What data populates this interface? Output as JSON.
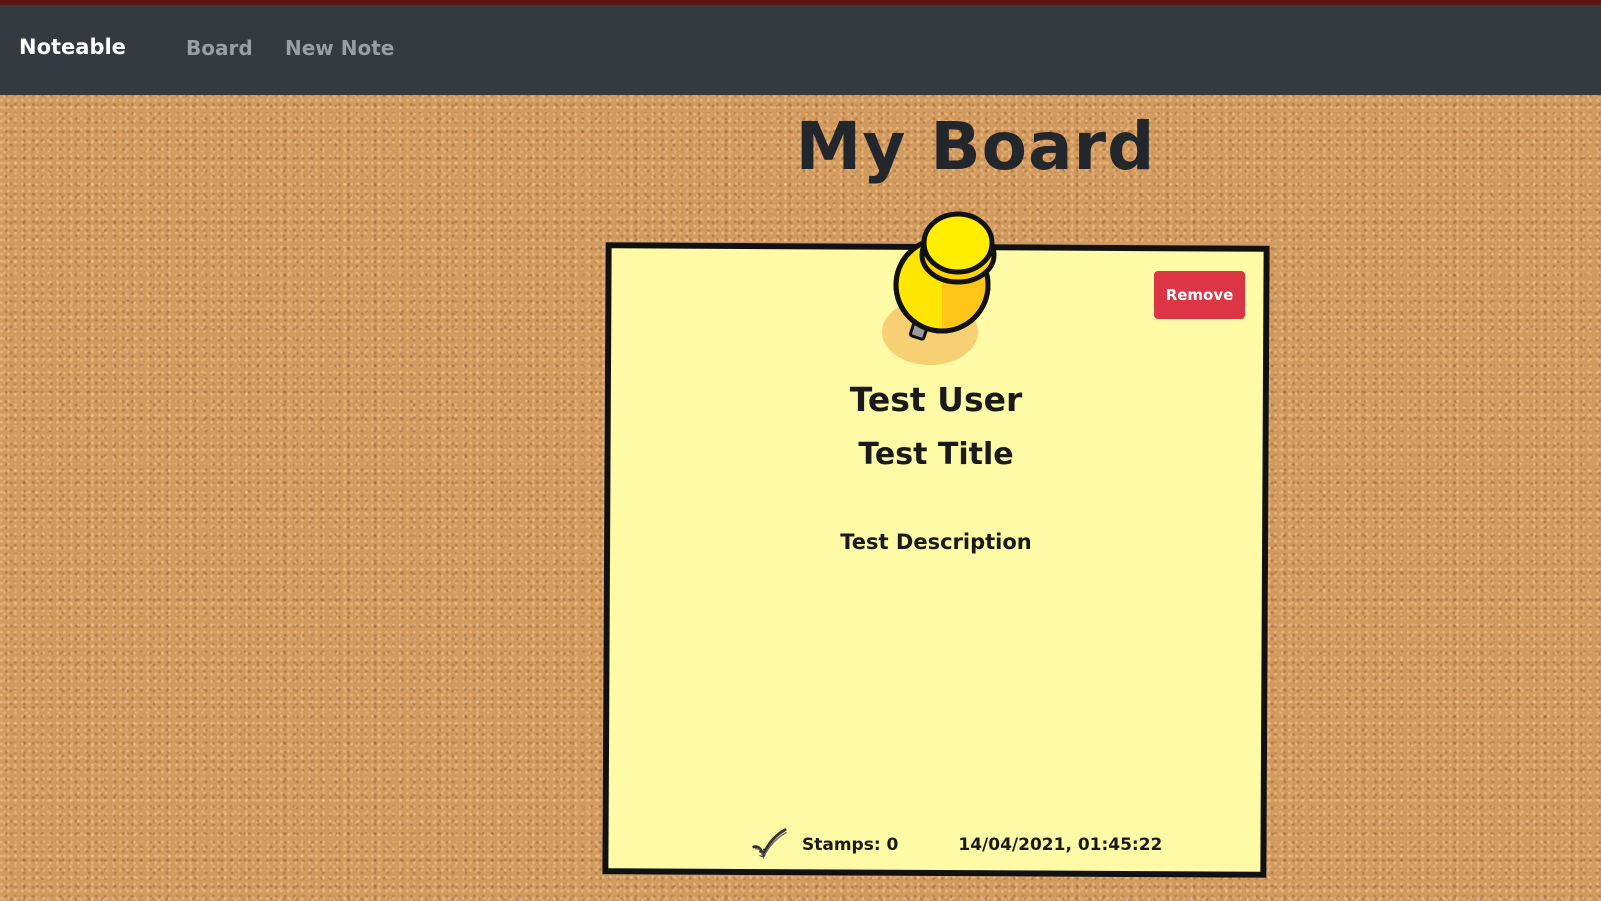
{
  "navbar": {
    "brand": "Noteable",
    "links": [
      {
        "label": "Board"
      },
      {
        "label": "New Note"
      }
    ]
  },
  "page": {
    "title": "My Board"
  },
  "note": {
    "user": "Test User",
    "title": "Test Title",
    "description": "Test Description",
    "remove_label": "Remove",
    "stamps_label": "Stamps: 0",
    "stamps_count": 0,
    "timestamp": "14/04/2021, 01:45:22",
    "pin_icon": "pushpin-icon",
    "stamp_icon": "checkmark-stamp-icon",
    "note_color": "#fefaa6",
    "pin_color": "#ffe600"
  },
  "colors": {
    "navbar": "#343a40",
    "remove_button": "#dc3545",
    "corkboard": "#d39a5e"
  }
}
